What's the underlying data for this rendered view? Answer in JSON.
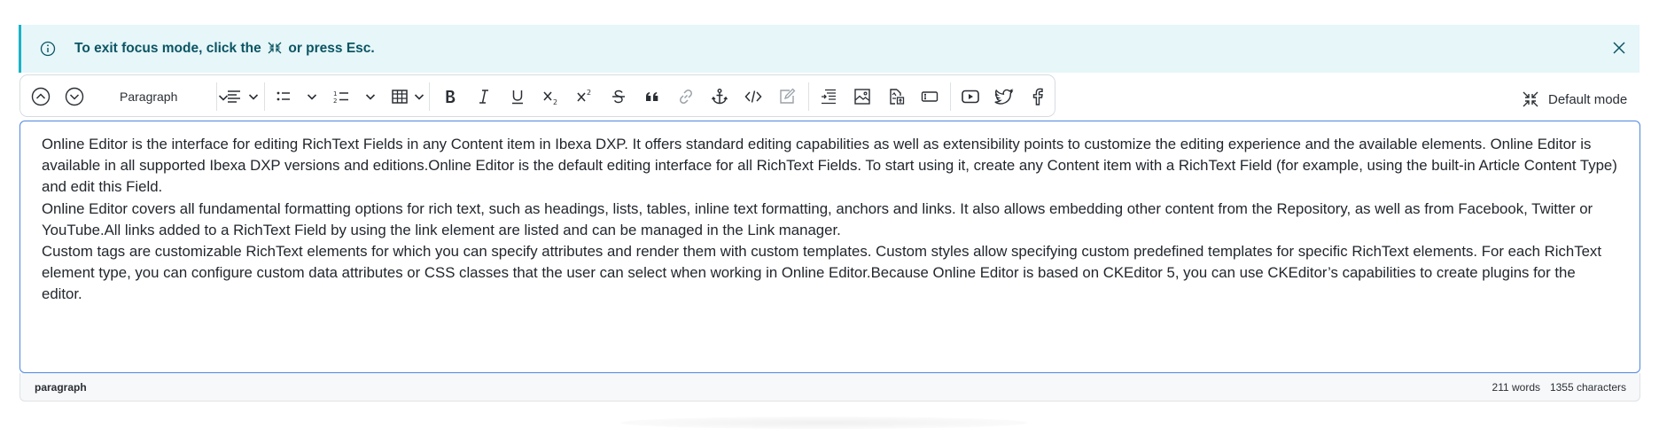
{
  "banner": {
    "message_before": "To exit focus mode, click the",
    "message_after": "or press Esc.",
    "accent": "#18b3c6",
    "background": "#e6f6f9"
  },
  "toolbar": {
    "heading_select": "Paragraph",
    "buttons": [
      "move-up",
      "move-down",
      "paragraph-format",
      "alignment",
      "bulleted-list",
      "numbered-list",
      "table",
      "bold",
      "italic",
      "underline",
      "subscript",
      "superscript",
      "strikethrough",
      "blockquote",
      "link",
      "anchor",
      "code",
      "custom-tag",
      "embed",
      "image",
      "file",
      "custom-style",
      "youtube",
      "twitter",
      "facebook"
    ]
  },
  "mode": {
    "label": "Default mode"
  },
  "editor": {
    "paragraphs": [
      "Online Editor is the interface for editing RichText Fields in any Content item in Ibexa DXP. It offers standard editing capabilities as well as extensibility points to customize the editing experience and the available elements. Online Editor is available in all supported Ibexa DXP versions and editions.Online Editor is the default editing interface for all RichText Fields. To start using it, create any Content item with a RichText Field (for example, using the built-in Article Content Type) and edit this Field.",
      "Online Editor covers all fundamental formatting options for rich text, such as headings, lists, tables, inline text formatting, anchors and links. It also allows embedding other content from the Repository, as well as from Facebook, Twitter or YouTube.All links added to a RichText Field by using the link element are listed and can be managed in the Link manager.",
      "Custom tags are customizable RichText elements for which you can specify attributes and render them with custom templates. Custom styles allow specifying custom predefined templates for specific RichText elements. For each RichText element type, you can configure custom data attributes or CSS classes that the user can select when working in Online Editor.Because Online Editor is based on CKEditor 5, you can use CKEditor’s capabilities to create plugins for the editor."
    ],
    "border_color": "#4e87df"
  },
  "status": {
    "path": "paragraph",
    "words": "211 words",
    "characters": "1355 characters"
  }
}
